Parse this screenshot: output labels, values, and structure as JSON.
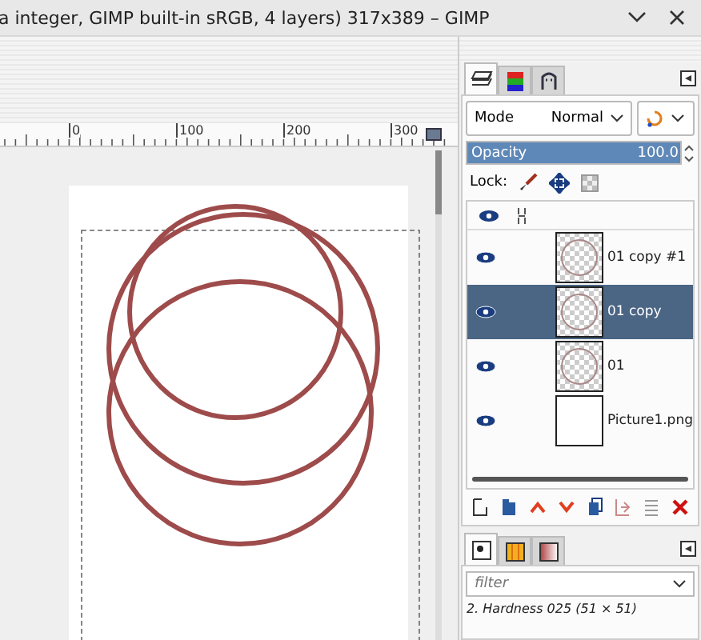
{
  "window": {
    "title": "a integer, GIMP built-in sRGB, 4 layers) 317x389 – GIMP"
  },
  "ruler": {
    "labels": [
      "0",
      "100",
      "200",
      "300"
    ]
  },
  "layers_panel": {
    "tabs": [
      {
        "kind": "layers",
        "selected": true
      },
      {
        "kind": "channels",
        "selected": false
      },
      {
        "kind": "paths",
        "selected": false
      }
    ],
    "mode": {
      "label": "Mode",
      "value": "Normal"
    },
    "opacity": {
      "label": "Opacity",
      "value": "100.0",
      "level": 1.0
    },
    "lock": {
      "label": "Lock:"
    },
    "layers": [
      {
        "name": "01 copy #1",
        "visible": true,
        "selected": false,
        "kind": "circle"
      },
      {
        "name": "01 copy",
        "visible": true,
        "selected": true,
        "kind": "circle"
      },
      {
        "name": "01",
        "visible": true,
        "selected": false,
        "kind": "circle"
      },
      {
        "name": "Picture1.png",
        "visible": true,
        "selected": false,
        "kind": "white"
      }
    ]
  },
  "brushes_panel": {
    "tabs": [
      {
        "kind": "brushes",
        "selected": true
      },
      {
        "kind": "patterns",
        "selected": false
      },
      {
        "kind": "gradients",
        "selected": false
      }
    ],
    "filter": {
      "placeholder": "filter"
    },
    "brush_name": "2. Hardness 025 (51 × 51)"
  }
}
